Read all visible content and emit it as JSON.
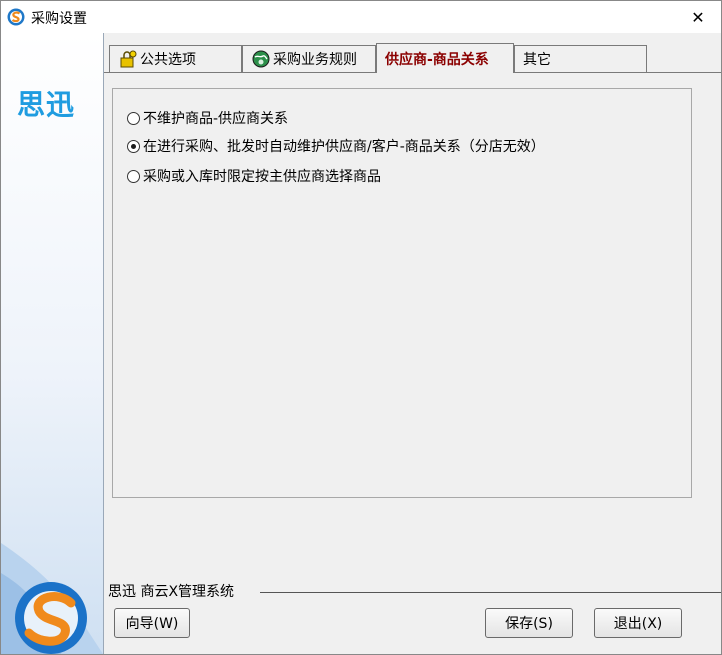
{
  "window": {
    "title": "采购设置",
    "close_symbol": "✕"
  },
  "sidebar": {
    "brand": "思迅"
  },
  "tabs": [
    {
      "label": "公共选项",
      "icon": "key-lock-icon"
    },
    {
      "label": "采购业务规则",
      "icon": "globe-icon"
    },
    {
      "label": "供应商-商品关系",
      "active": true
    },
    {
      "label": "其它"
    }
  ],
  "options": [
    {
      "label": "不维护商品-供应商关系",
      "checked": false
    },
    {
      "label": "在进行采购、批发时自动维护供应商/客户-商品关系（分店无效）",
      "checked": true
    },
    {
      "label": "采购或入库时限定按主供应商选择商品",
      "checked": false
    }
  ],
  "footer": {
    "system_name": "思迅 商云X管理系统",
    "wizard_label": "向导(W)",
    "save_label": "保存(S)",
    "exit_label": "退出(X)"
  }
}
